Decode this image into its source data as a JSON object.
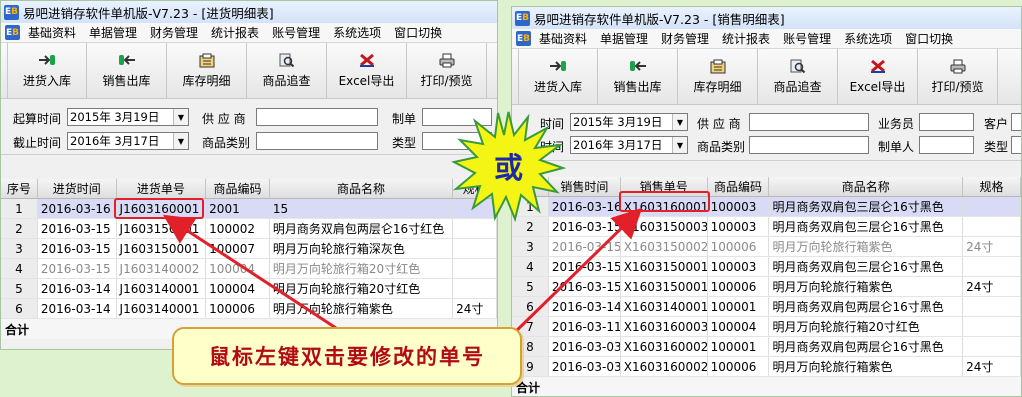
{
  "left": {
    "title": "易吧进销存软件单机版-V7.23 - [进货明细表]",
    "menu": [
      "基础资料",
      "单据管理",
      "财务管理",
      "统计报表",
      "账号管理",
      "系统选项",
      "窗口切换"
    ],
    "toolbar": [
      {
        "label": "进货入库",
        "icon": "stock-in-icon"
      },
      {
        "label": "销售出库",
        "icon": "sale-out-icon"
      },
      {
        "label": "库存明细",
        "icon": "inventory-icon"
      },
      {
        "label": "商品追查",
        "icon": "search-icon"
      },
      {
        "label": "Excel导出",
        "icon": "excel-icon"
      },
      {
        "label": "打印/预览",
        "icon": "printer-icon"
      }
    ],
    "filters": {
      "start_label": "起算时间",
      "start_value": "2015年  3月19日",
      "end_label": "截止时间",
      "end_value": "2016年  3月17日",
      "supplier_label": "供 应 商",
      "category_label": "商品类别",
      "maker_label": "制单",
      "type_label": "类型"
    },
    "headers": [
      "序号",
      "进货时间",
      "进货单号",
      "商品编码",
      "商品名称",
      "规格"
    ],
    "rows": [
      [
        "1",
        "2016-03-16",
        "J1603160001",
        "2001",
        "15",
        ""
      ],
      [
        "2",
        "2016-03-15",
        "J1603150001",
        "100002",
        "明月商务双肩包两层仑16寸红色",
        ""
      ],
      [
        "3",
        "2016-03-15",
        "J1603150001",
        "100007",
        "明月万向轮旅行箱深灰色",
        ""
      ],
      [
        "4",
        "2016-03-15",
        "J1603140002",
        "100004",
        "明月万向轮旅行箱20寸红色",
        ""
      ],
      [
        "5",
        "2016-03-14",
        "J1603140001",
        "100004",
        "明月万向轮旅行箱20寸红色",
        ""
      ],
      [
        "6",
        "2016-03-14",
        "J1603140001",
        "100006",
        "明月万向轮旅行箱紫色",
        "24寸"
      ]
    ],
    "total_label": "合计"
  },
  "right": {
    "title": "易吧进销存软件单机版-V7.23 - [销售明细表]",
    "menu": [
      "基础资料",
      "单据管理",
      "财务管理",
      "统计报表",
      "账号管理",
      "系统选项",
      "窗口切换"
    ],
    "toolbar": [
      {
        "label": "进货入库",
        "icon": "stock-in-icon"
      },
      {
        "label": "销售出库",
        "icon": "sale-out-icon"
      },
      {
        "label": "库存明细",
        "icon": "inventory-icon"
      },
      {
        "label": "商品追查",
        "icon": "search-icon"
      },
      {
        "label": "Excel导出",
        "icon": "excel-icon"
      },
      {
        "label": "打印/预览",
        "icon": "printer-icon"
      }
    ],
    "filters": {
      "start_label": "时间",
      "start_value": "2015年  3月19日",
      "end_label": "时间",
      "end_value": "2016年  3月17日",
      "supplier_label": "供 应 商",
      "category_label": "商品类别",
      "clerk_label": "业务员",
      "maker_label": "制单人",
      "customer_label": "客户",
      "type_label": "类型"
    },
    "headers": [
      "",
      "销售时间",
      "销售单号",
      "商品编码",
      "商品名称",
      "规格"
    ],
    "rows": [
      [
        "1",
        "2016-03-16",
        "X1603160001",
        "100003",
        "明月商务双肩包三层仑16寸黑色",
        ""
      ],
      [
        "2",
        "2016-03-15",
        "X1603150003",
        "100003",
        "明月商务双肩包三层仑16寸黑色",
        ""
      ],
      [
        "3",
        "2016-03-15",
        "X1603150002",
        "100006",
        "明月万向轮旅行箱紫色",
        "24寸"
      ],
      [
        "4",
        "2016-03-15",
        "X1603150001",
        "100003",
        "明月商务双肩包三层仑16寸黑色",
        ""
      ],
      [
        "5",
        "2016-03-15",
        "X1603150001",
        "100006",
        "明月万向轮旅行箱紫色",
        "24寸"
      ],
      [
        "6",
        "2016-03-14",
        "X1603140001",
        "100001",
        "明月商务双肩包两层仑16寸黑色",
        ""
      ],
      [
        "7",
        "2016-03-11",
        "X1603160003",
        "100004",
        "明月万向轮旅行箱20寸红色",
        ""
      ],
      [
        "8",
        "2016-03-03",
        "X1603160002",
        "100001",
        "明月商务双肩包两层仑16寸黑色",
        ""
      ],
      [
        "9",
        "2016-03-03",
        "X1603160002",
        "100006",
        "明月万向轮旅行箱紫色",
        "24寸"
      ]
    ],
    "total_label": "合计"
  },
  "or_badge": "或",
  "callout": "鼠标左键双击要修改的单号",
  "colors": {
    "highlight": "#e2202a",
    "selected_row": "#d9dbf6",
    "callout_text": "#b30b16",
    "or_text": "#1c2aa8",
    "burst": "#f5f515"
  }
}
